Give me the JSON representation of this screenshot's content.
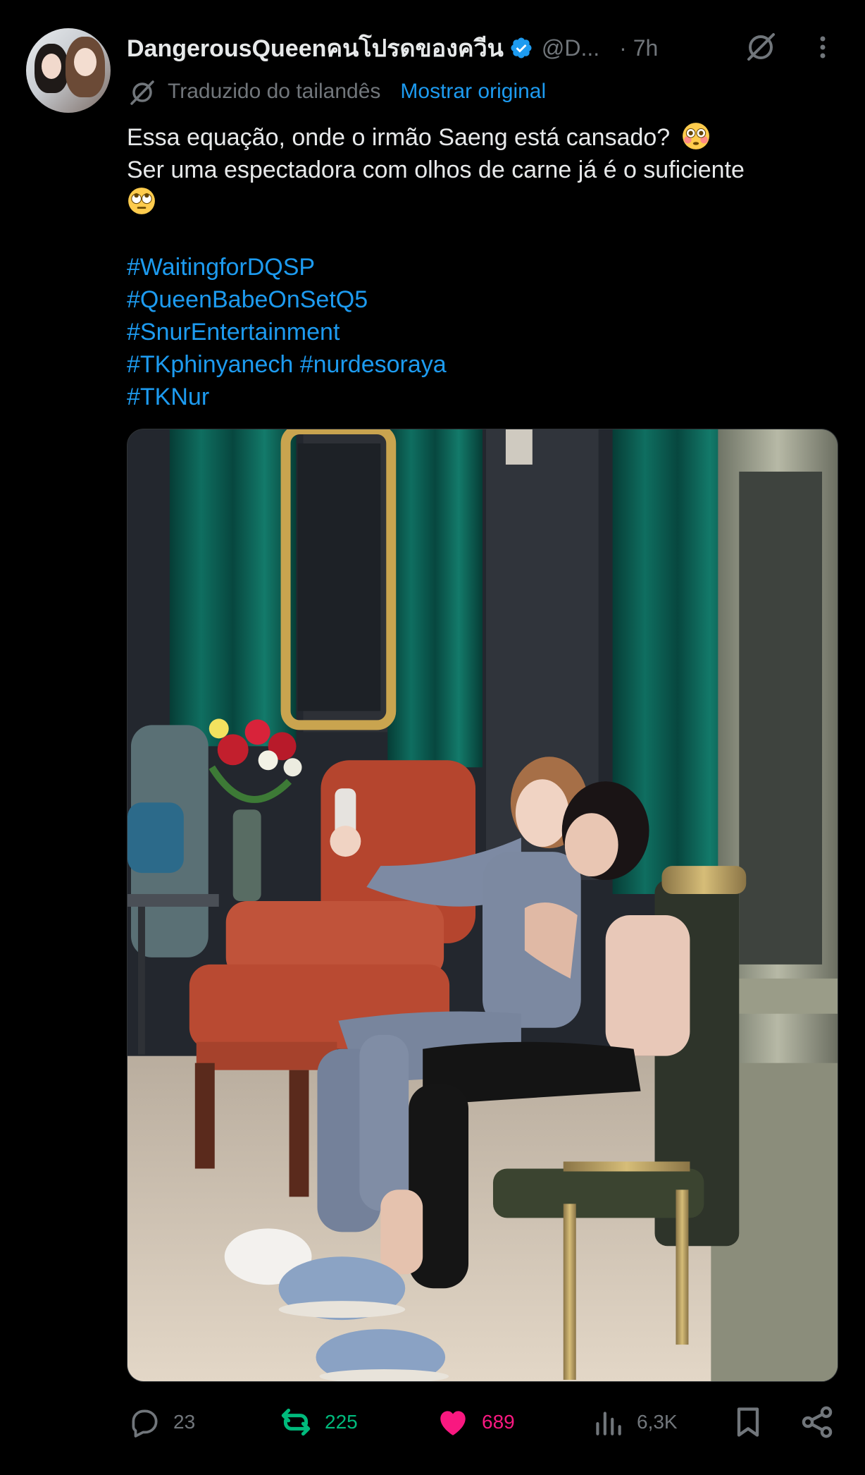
{
  "post": {
    "author_name": "DangerousQueenคนโปรดของควีน",
    "handle": "@D...",
    "time": "· 7h",
    "translation": {
      "label": "Traduzido do tailandês",
      "show_original": "Mostrar original"
    },
    "text_lines": [
      "Essa equação, onde o irmão Saeng está cansado?",
      "Ser uma espectadora com olhos de carne já é o suficiente"
    ],
    "emojis": [
      "flushed-face-emoji",
      "rolling-eyes-emoji"
    ],
    "hashtags": [
      "#WaitingforDQSP",
      "#QueenBabeOnSetQ5",
      "#SnurEntertainment",
      "#TKphinyanech",
      "#nurdesoraya",
      "#TKNur"
    ],
    "media": {
      "alt": "photo"
    },
    "metrics": {
      "replies": "23",
      "reposts": "225",
      "likes": "689",
      "views": "6,3K"
    }
  },
  "icons": {
    "verified": "verified-badge-icon",
    "grok": "grok-icon",
    "more": "more-icon",
    "translate": "translate-icon",
    "reply": "reply-icon",
    "repost": "repost-icon",
    "like": "heart-icon",
    "views": "views-icon",
    "bookmark": "bookmark-icon",
    "share": "share-icon"
  },
  "colors": {
    "background": "#000000",
    "text": "#e7e9ea",
    "muted": "#71767b",
    "link": "#1d9bf0",
    "repost": "#00ba7c",
    "like": "#f91880"
  }
}
